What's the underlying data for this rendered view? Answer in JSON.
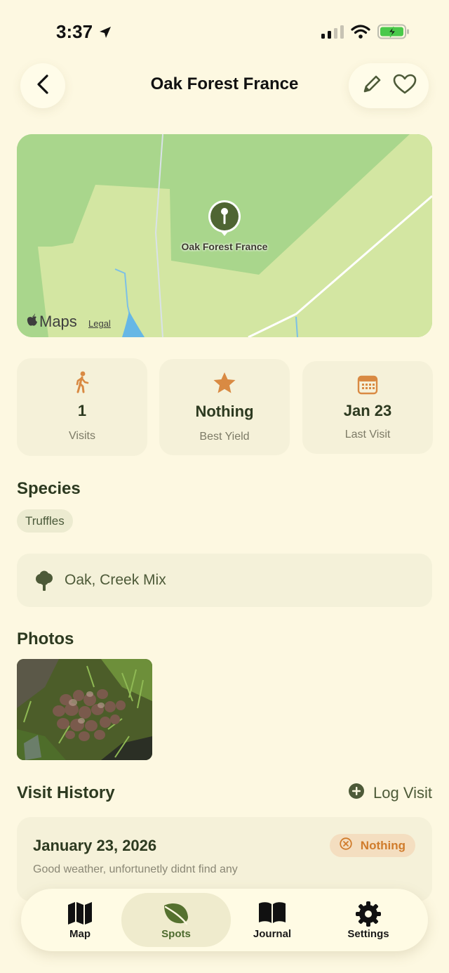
{
  "status": {
    "time": "3:37"
  },
  "header": {
    "title": "Oak Forest France"
  },
  "map": {
    "pin_label": "Oak Forest France",
    "brand": "Maps",
    "legal": "Legal"
  },
  "stats": [
    {
      "icon": "walking-icon",
      "value": "1",
      "label": "Visits"
    },
    {
      "icon": "star-icon",
      "value": "Nothing",
      "label": "Best Yield"
    },
    {
      "icon": "calendar-icon",
      "value": "Jan 23",
      "label": "Last Visit"
    }
  ],
  "species": {
    "title": "Species",
    "items": [
      "Truffles"
    ]
  },
  "habitat": {
    "icon": "tree-icon",
    "text": "Oak, Creek Mix"
  },
  "photos": {
    "title": "Photos"
  },
  "visit_history": {
    "title": "Visit History",
    "log_visit_label": "Log Visit",
    "entries": [
      {
        "date": "January 23, 2026",
        "result": "Nothing",
        "note": "Good weather, unfortunetly didnt find any"
      }
    ]
  },
  "tabbar": {
    "active": "Spots",
    "items": [
      {
        "icon": "map-icon",
        "label": "Map"
      },
      {
        "icon": "leaf-icon",
        "label": "Spots"
      },
      {
        "icon": "book-icon",
        "label": "Journal"
      },
      {
        "icon": "gear-icon",
        "label": "Settings"
      }
    ]
  },
  "colors": {
    "background": "#fdf8e1",
    "accent_green": "#4d6a2e",
    "accent_orange": "#d98a43",
    "card": "#f5f1d9"
  }
}
